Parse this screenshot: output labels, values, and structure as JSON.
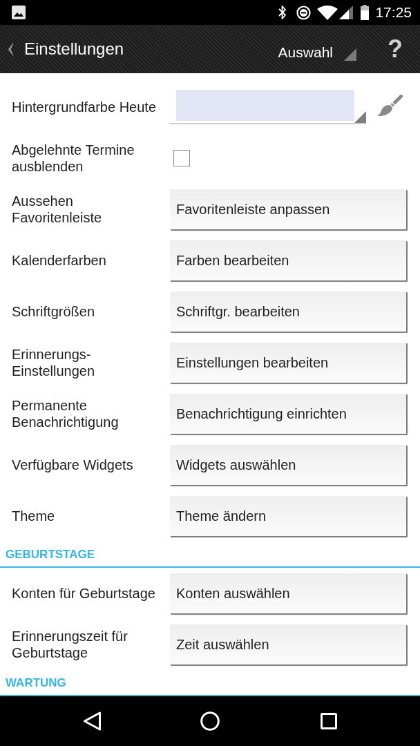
{
  "status_bar": {
    "time": "17:25"
  },
  "action_bar": {
    "title": "Einstellungen",
    "dropdown": "Auswahl",
    "help": "?"
  },
  "sections": [
    {
      "rows": [
        {
          "kind": "color",
          "label": "Hintergrundfarbe Heute",
          "color": "#e3e6f6"
        },
        {
          "kind": "checkbox",
          "label": "Abgelehnte Termine ausblenden",
          "checked": false
        },
        {
          "kind": "button",
          "label": "Aussehen Favoritenleiste",
          "button": "Favoritenleiste anpassen"
        },
        {
          "kind": "button",
          "label": "Kalenderfarben",
          "button": "Farben bearbeiten"
        },
        {
          "kind": "button",
          "label": "Schriftgrößen",
          "button": "Schriftgr. bearbeiten"
        },
        {
          "kind": "button",
          "label": "Erinnerungs-Einstellungen",
          "button": "Einstellungen bearbeiten"
        },
        {
          "kind": "button",
          "label": "Permanente Benachrichtigung",
          "button": "Benachrichtigung einrichten"
        },
        {
          "kind": "button",
          "label": "Verfügbare Widgets",
          "button": "Widgets auswählen"
        },
        {
          "kind": "button",
          "label": "Theme",
          "button": "Theme ändern"
        }
      ]
    },
    {
      "header": "GEBURTSTAGE",
      "rows": [
        {
          "kind": "button",
          "label": "Konten für Geburtstage",
          "button": "Konten auswählen"
        },
        {
          "kind": "button",
          "label": "Erinnerungszeit für Geburtstage",
          "button": "Zeit auswählen"
        }
      ]
    },
    {
      "header": "WARTUNG"
    }
  ]
}
